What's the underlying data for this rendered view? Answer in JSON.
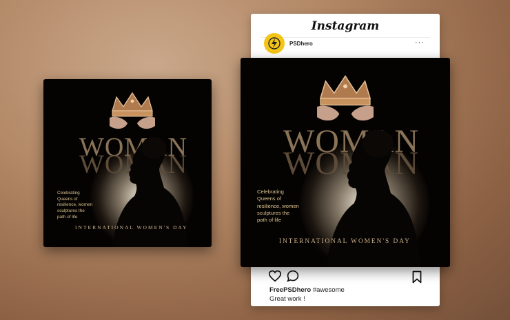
{
  "instagram": {
    "logo_text": "Instagram",
    "username": "PSDhero",
    "more_menu": "···",
    "caption_handle": "FreePSDhero",
    "caption_tag": "#awesome",
    "comment": "Great work !",
    "icons": [
      "avatar-logo-icon",
      "more-options-icon",
      "heart-icon",
      "comment-icon",
      "bookmark-icon"
    ]
  },
  "poster": {
    "headline": "WOMAN",
    "caption": [
      "Celebrating",
      "Queens of",
      "resilience, women",
      "sculptures the",
      "path of life"
    ],
    "tagline": "INTERNATIONAL WOMEN'S DAY"
  },
  "colors": {
    "background": "#a87c5a",
    "poster_bg": "#050302",
    "gold": "#cdb58e",
    "avatar_yellow": "#f4c516"
  }
}
